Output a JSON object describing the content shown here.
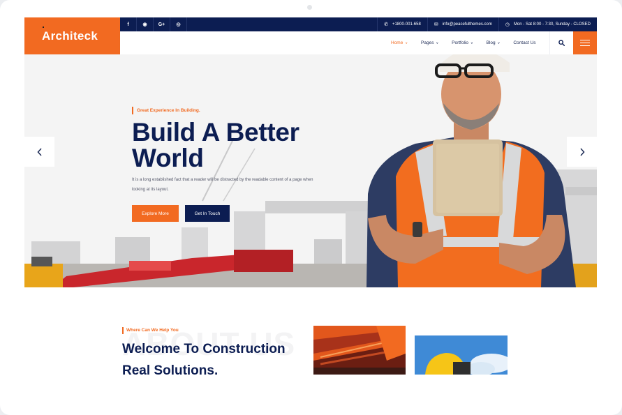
{
  "brand": {
    "logo": "Architeck",
    "accent": "#f26a21",
    "navy": "#0c1d52"
  },
  "topbar": {
    "social": [
      {
        "icon": "facebook-icon",
        "glyph": "f"
      },
      {
        "icon": "github-icon",
        "glyph": "◉"
      },
      {
        "icon": "google-plus-icon",
        "glyph": "G+"
      },
      {
        "icon": "instagram-icon",
        "glyph": "◎"
      }
    ],
    "phone": "+1800-001-658",
    "email": "info@peacefulthemes.com",
    "hours": "Mon - Sat 8:00 - 7:30, Sunday - CLOSED"
  },
  "nav": {
    "items": [
      {
        "label": "Home",
        "dropdown": true
      },
      {
        "label": "Pages",
        "dropdown": true
      },
      {
        "label": "Portfolio",
        "dropdown": true
      },
      {
        "label": "Blog",
        "dropdown": true
      },
      {
        "label": "Contact Us",
        "dropdown": false
      }
    ],
    "active": "Home"
  },
  "hero": {
    "subtitle": "Great Experience In Building.",
    "title_line1": "Build A Better",
    "title_line2": "World",
    "description": "It is a long established fact that a reader will be distracted by the readable content of a page when looking at its layout.",
    "primary_button": "Explore More",
    "secondary_button": "Get In Touch"
  },
  "about": {
    "watermark": "ABOUT US",
    "subtitle": "Where Can We Help You",
    "title_line1": "Welcome To Construction",
    "title_line2": "Real Solutions."
  }
}
